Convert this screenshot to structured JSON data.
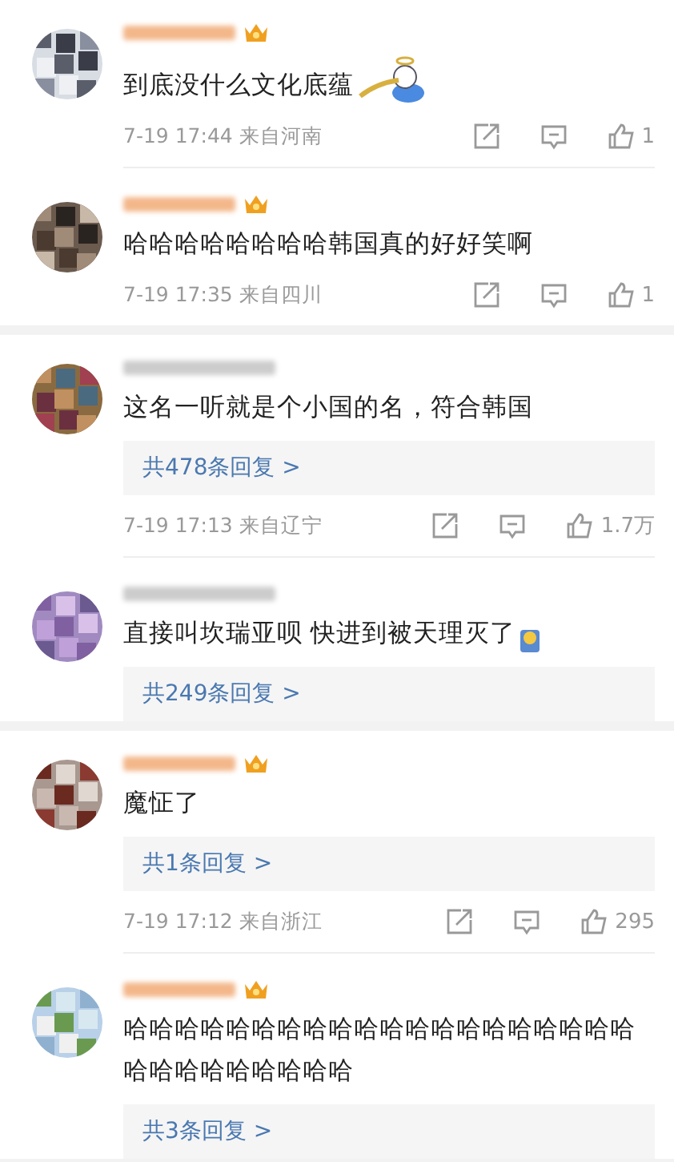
{
  "sections": [
    {
      "comments": [
        {
          "vip": true,
          "text": "到底没什么文化底蕴",
          "sticker": true,
          "time": "7-19 17:44",
          "location": "来自河南",
          "likes": "1"
        },
        {
          "vip": true,
          "text": "哈哈哈哈哈哈哈哈韩国真的好好笑啊",
          "time": "7-19 17:35",
          "location": "来自四川",
          "likes": "1"
        }
      ]
    },
    {
      "comments": [
        {
          "vip": false,
          "text": "这名一听就是个小国的名，符合韩国",
          "replies": "共478条回复 >",
          "time": "7-19 17:13",
          "location": "来自辽宁",
          "likes": "1.7万"
        },
        {
          "vip": false,
          "text": "直接叫坎瑞亚呗 快进到被天理灭了",
          "emoji": true,
          "replies": "共249条回复 >"
        }
      ]
    },
    {
      "comments": [
        {
          "vip": true,
          "text": "魔怔了",
          "replies": "共1条回复 >",
          "time": "7-19 17:12",
          "location": "来自浙江",
          "likes": "295"
        },
        {
          "vip": true,
          "text": "哈哈哈哈哈哈哈哈哈哈哈哈哈哈哈哈哈哈哈哈哈哈哈哈哈哈哈哈哈",
          "replies": "共3条回复 >"
        }
      ]
    }
  ]
}
